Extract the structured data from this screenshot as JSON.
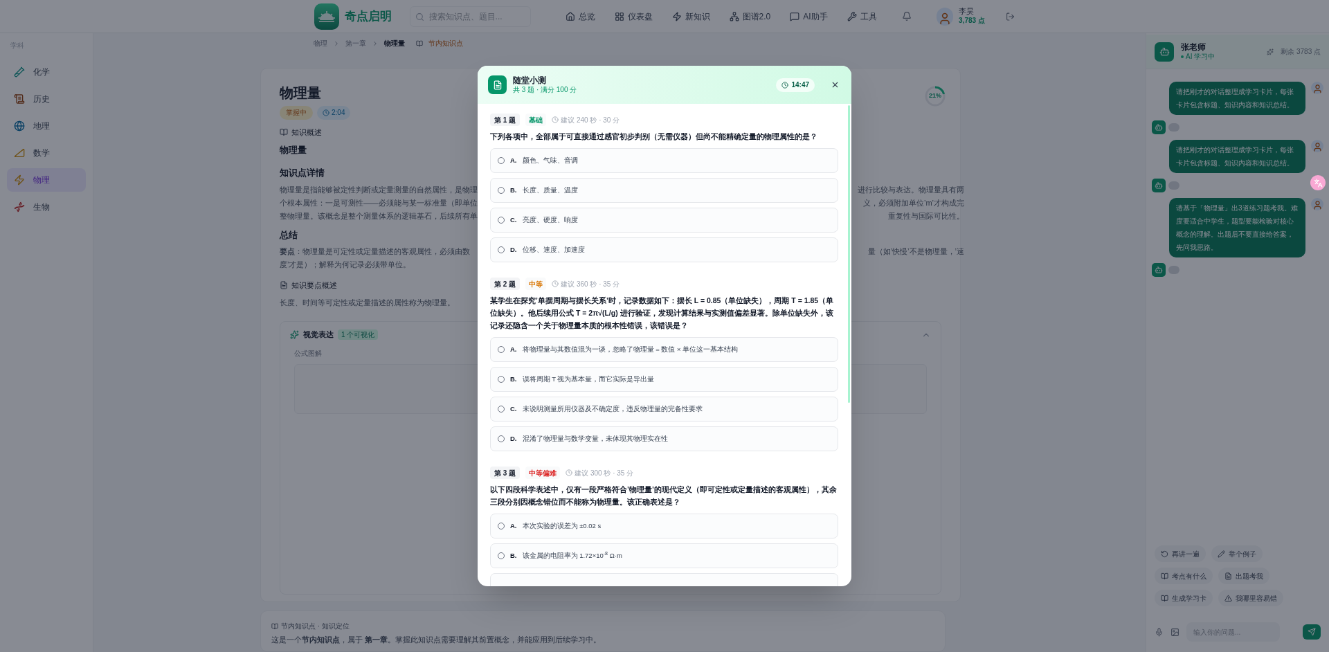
{
  "header": {
    "logo_text": "奇点启明",
    "search": {
      "placeholder": "搜索知识点、题目..."
    },
    "nav": [
      {
        "label": "总览"
      },
      {
        "label": "仪表盘"
      },
      {
        "label": "新知识"
      },
      {
        "label": "图谱2.0"
      },
      {
        "label": "AI助手"
      },
      {
        "label": "工具"
      }
    ],
    "user": {
      "name": "李昊",
      "points": "3,783 点"
    }
  },
  "breadcrumb": {
    "items": [
      "物理",
      "第一章",
      "物理量"
    ],
    "badge": "节内知识点"
  },
  "sidebar": {
    "title": "学科",
    "items": [
      {
        "label": "化学",
        "selected": false
      },
      {
        "label": "历史",
        "selected": false
      },
      {
        "label": "地理",
        "selected": false
      },
      {
        "label": "数学",
        "selected": false
      },
      {
        "label": "物理",
        "selected": true
      },
      {
        "label": "生物",
        "selected": false
      }
    ]
  },
  "knowledge": {
    "title": "物理量",
    "status": "掌握中",
    "time": "2:04",
    "progress": "21%",
    "level": 0.21,
    "overview_heading": "知识概述",
    "name": "物理量",
    "detail_heading": "知识点详情",
    "detail_lines": [
      {
        "left": "物理量是指能够被定性判断或定量测量的自然属性，是物理",
        "right": "进行比较与表达。物理量具有两"
      },
      {
        "left": "个根本属性：一是可测性——必须能与某一标准量（即单位",
        "right": "义，必须附加单位’m’才构成完"
      },
      {
        "left": "整物理量。该概念是整个测量体系的逻辑基石，后续所有单",
        "right": "重复性与国际可比性。"
      }
    ],
    "summary_heading": "总结",
    "summary_lines": [
      {
        "left": "**要点**：物理量是可定性或定量描述的客观属性，必须由数",
        "right": "量（如’快慢’不是物理量，’速"
      },
      {
        "left": "度’才是）；解释为何记录必须带单位。"
      }
    ],
    "keypoints_heading": "知识要点概述",
    "keypoint": "长度、时间等可定性或定量描述的属性称为物理量。",
    "visual": {
      "title": "视觉表达",
      "count": "1 个可视化",
      "expanded": true,
      "item_label": "公式图解"
    },
    "section_info": {
      "label": "节内知识点 · 知识定位",
      "text": "这是一个**节内知识点**，属于 **第一章**。掌握此知识点需要理解其前置概念，并能应用到后续学习中。"
    }
  },
  "chat": {
    "name": "张老师",
    "status": "AI 学习中",
    "credits": "剩余 3783 点",
    "messages": [
      {
        "kind": "user",
        "text": "请把刚才的对话整理成学习卡片，每张卡片包含标题、知识内容和知识总结。"
      },
      {
        "kind": "assistant"
      },
      {
        "kind": "user",
        "text": "请把刚才的对话整理成学习卡片，每张卡片包含标题、知识内容和知识总结。"
      },
      {
        "kind": "assistant"
      },
      {
        "kind": "user",
        "text": "请基于「物理量」出3道练习题考我。难度要适合中学生，题型要能检验对核心概念的理解。出题后不要直接给答案，先问我思路。"
      },
      {
        "kind": "assistant"
      }
    ],
    "quick_actions": [
      {
        "label": "再讲一遍"
      },
      {
        "label": "举个例子"
      },
      {
        "label": "考点有什么"
      },
      {
        "label": "出题考我"
      },
      {
        "label": "生成学习卡"
      },
      {
        "label": "我哪里容易错"
      }
    ],
    "input": {
      "placeholder": "输入你的问题..."
    }
  },
  "quiz": {
    "title": "随堂小测",
    "subtitle": "共 3 题 · 满分 100 分",
    "timer": "14:47",
    "questions": [
      {
        "number": "第 1 题",
        "difficulty": "基础",
        "color": "#059669",
        "hint": "建议 240 秒 · 30 分",
        "text": "下列各项中，全部属于可直接通过感官初步判别（无需仪器）但尚不能精确定量的物理属性的是？",
        "options": [
          {
            "letter": "A.",
            "text": "颜色、气味、音调",
            "selected": false
          },
          {
            "letter": "B.",
            "text": "长度、质量、温度",
            "selected": false
          },
          {
            "letter": "C.",
            "text": "亮度、硬度、响度",
            "selected": false
          },
          {
            "letter": "D.",
            "text": "位移、速度、加速度",
            "selected": false
          }
        ]
      },
      {
        "number": "第 2 题",
        "difficulty": "中等",
        "color": "#d97706",
        "hint": "建议 360 秒 · 35 分",
        "text": "某学生在探究’单摆周期与摆长关系’时，记录数据如下：摆长 L = 0.85（单位缺失），周期 T = 1.85（单位缺失）。他后续用公式 T = 2π√(L/g) 进行验证，发现计算结果与实测值偏差显著。除单位缺失外，该记录还隐含一个关于物理量本质的根本性错误，该错误是？",
        "options": [
          {
            "letter": "A.",
            "text": "将物理量与其数值混为一谈，忽略了物理量 = 数值 × 单位这一基本结构",
            "selected": false
          },
          {
            "letter": "B.",
            "text": "误将周期 T 视为基本量，而它实际是导出量",
            "selected": false
          },
          {
            "letter": "C.",
            "text": "未说明测量所用仪器及不确定度，违反物理量的完备性要求",
            "selected": false
          },
          {
            "letter": "D.",
            "text": "混淆了物理量与数学变量，未体现其物理实在性",
            "selected": false
          }
        ]
      },
      {
        "number": "第 3 题",
        "difficulty": "中等偏难",
        "color": "#dc2626",
        "hint": "建议 300 秒 · 35 分",
        "text": "以下四段科学表述中，仅有一段严格符合’物理量’的现代定义（即可定性或定量描述的客观属性），其余三段分别因概念错位而不能称为物理量。该正确表述是？",
        "options": [
          {
            "letter": "A.",
            "text": "本次实验的误差为 ±0.02 s",
            "selected": false
          },
          {
            "letter": "B.",
            "text": "该金属的电阻率为 1.72×10$^{-8}$ Ω·m",
            "selected": false
          }
        ]
      }
    ]
  }
}
